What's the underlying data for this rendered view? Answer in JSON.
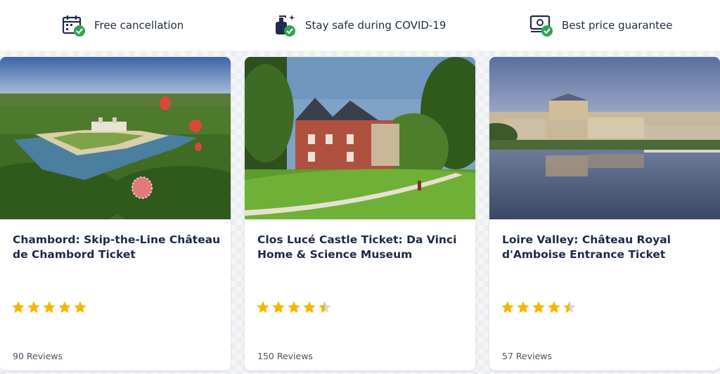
{
  "features": [
    {
      "label": "Free cancellation",
      "icon": "calendar-check-icon"
    },
    {
      "label": "Stay safe during COVID-19",
      "icon": "sanitizer-check-icon"
    },
    {
      "label": "Best price guarantee",
      "icon": "money-check-icon"
    }
  ],
  "colors": {
    "accent_green": "#2ea44f",
    "icon_navy": "#1f2d4d",
    "star_gold": "#f7b500",
    "star_empty": "#d9d9d9"
  },
  "cards": [
    {
      "title": "Chambord: Skip-the-Line Château de Chambord Ticket",
      "rating": 5,
      "reviews": "90 Reviews",
      "image": "aerial view of Château de Chambord with hot air balloons"
    },
    {
      "title": "Clos Lucé Castle Ticket: Da Vinci Home & Science Museum",
      "rating": 4.5,
      "reviews": "150 Reviews",
      "image": "brick castle Clos Lucé with lawn and trees"
    },
    {
      "title": "Loire Valley: Château Royal d'Amboise Entrance Ticket",
      "rating": 4.5,
      "reviews": "57 Reviews",
      "image": "Château d'Amboise reflected in Loire river at dusk"
    }
  ]
}
